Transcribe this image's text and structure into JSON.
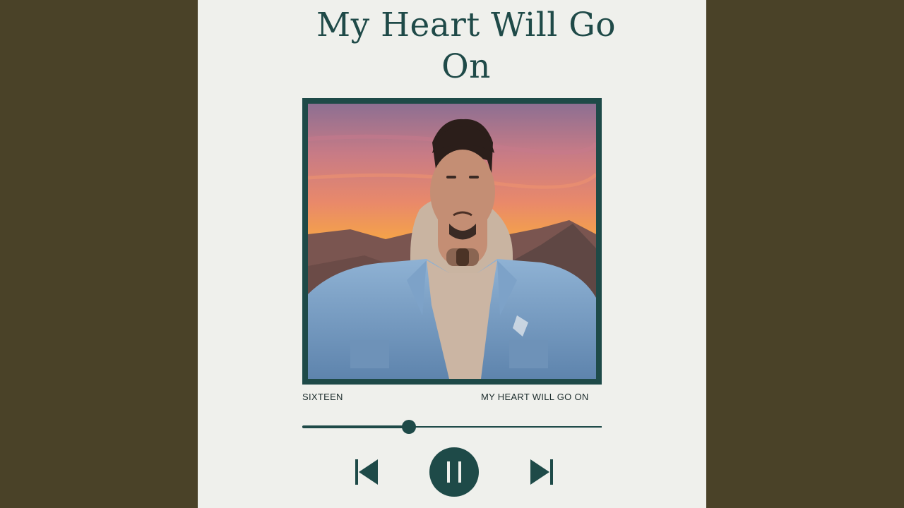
{
  "player": {
    "title_line1": "My Heart Will Go",
    "title_line2": "On",
    "artist_label": "SIXTEEN",
    "song_label": "MY HEART WILL GO ON",
    "progress": 0.355
  },
  "icons": {
    "previous": "skip-previous-icon",
    "pause": "pause-icon",
    "next": "skip-next-icon"
  },
  "colors": {
    "background": "#4a4228",
    "panel": "#eff0ec",
    "accent": "#1e4a48"
  }
}
